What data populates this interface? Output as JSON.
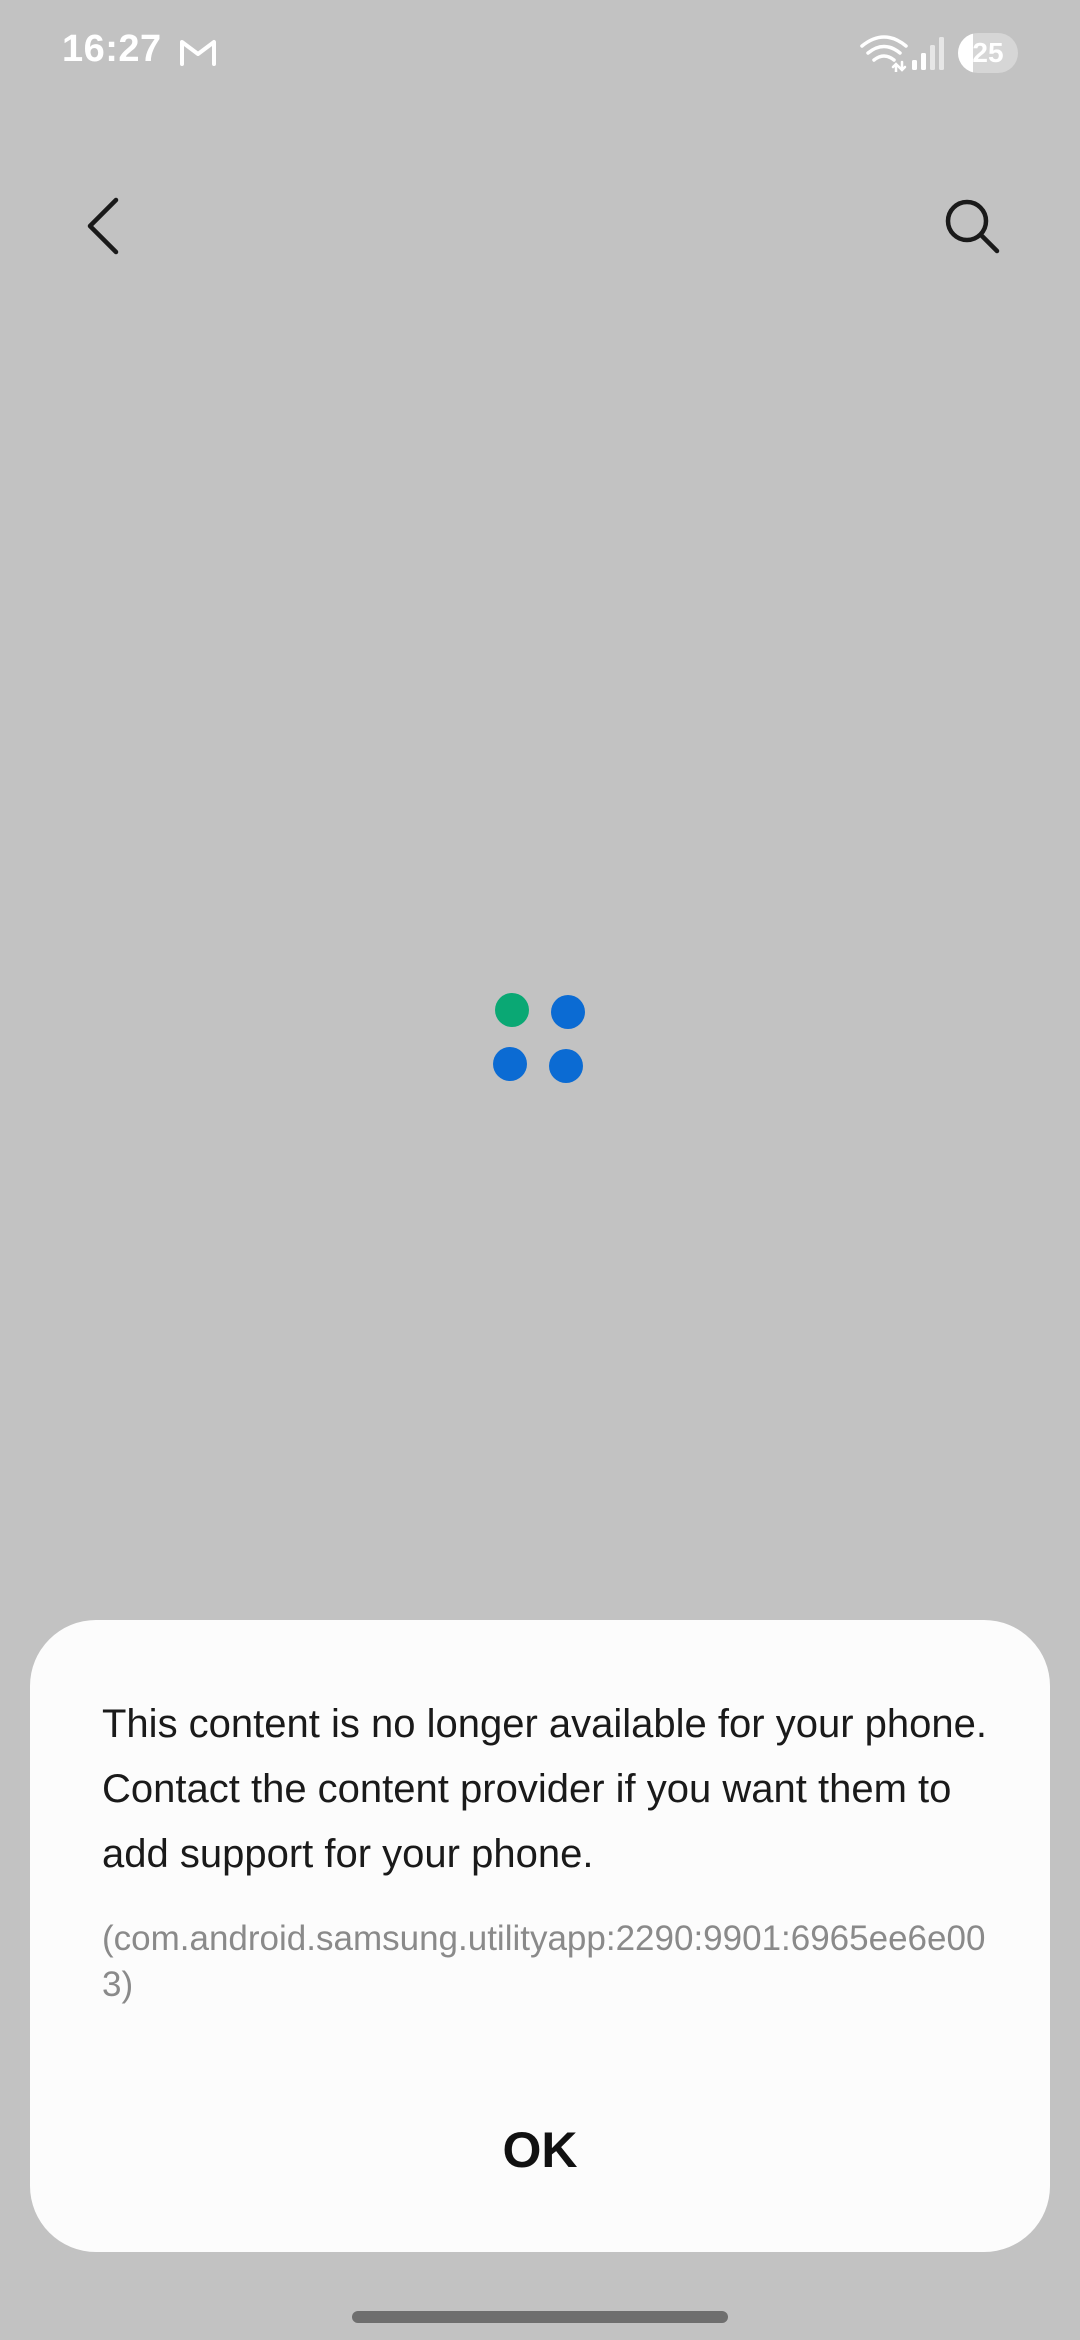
{
  "status_bar": {
    "time": "16:27",
    "battery_level": "25",
    "icons": [
      "gmail-icon",
      "wifi-icon",
      "signal-icon",
      "battery-icon"
    ]
  },
  "toolbar": {
    "icons": [
      "back-arrow-icon",
      "search-icon"
    ]
  },
  "loading": {
    "colors": [
      "#0aa874",
      "#0b6bd3",
      "#0b6bd3",
      "#0b6bd3"
    ]
  },
  "dialog": {
    "message": "This content is no longer available for your phone. Contact the content provider if you want them to add support for your phone.",
    "code": "(com.android.samsung.utilityapp:2290:9901:6965ee6e003)",
    "ok_label": "OK"
  },
  "colors": {
    "background": "#c2c2c2",
    "dialog_background": "#fcfcfc",
    "secondary_text": "#8a8a8a"
  }
}
